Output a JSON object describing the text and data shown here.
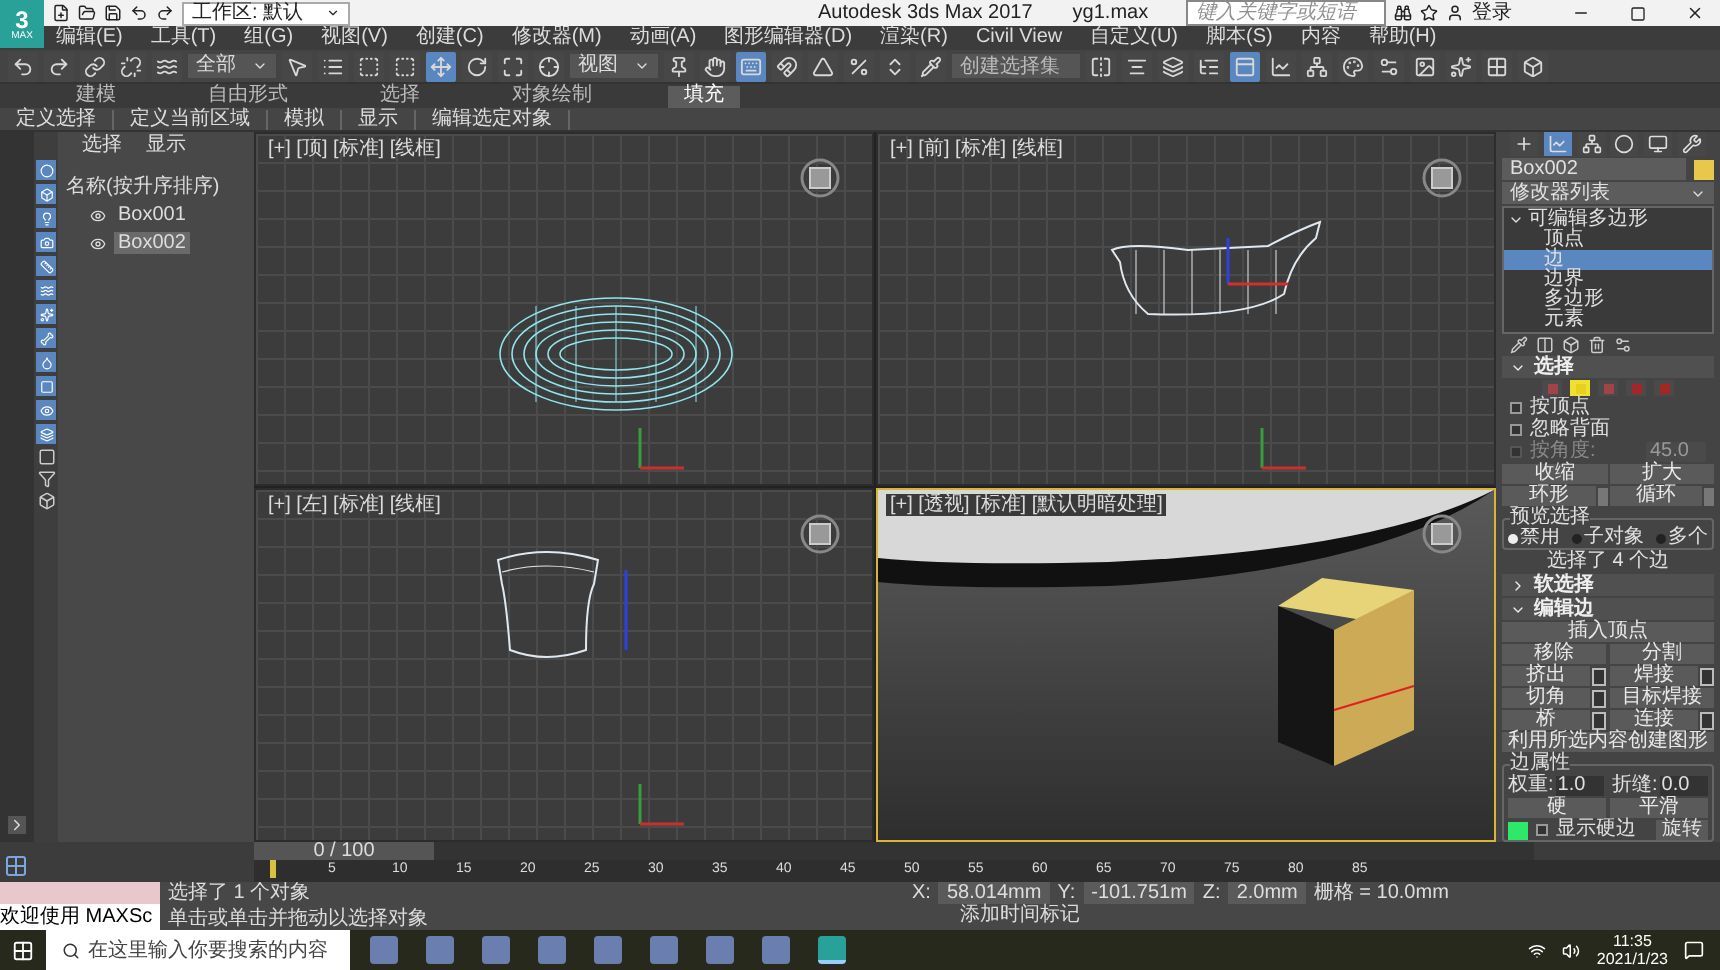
{
  "window": {
    "logo": "3",
    "logo_caption": "MAX",
    "workspace": "工作区: 默认",
    "app_title": "Autodesk 3ds Max 2017",
    "file_name": "yg1.max",
    "search": {
      "placeholder": "键入关键字或短语"
    },
    "sign_in": "登录"
  },
  "menu": [
    "编辑(E)",
    "工具(T)",
    "组(G)",
    "视图(V)",
    "创建(C)",
    "修改器(M)",
    "动画(A)",
    "图形编辑器(D)",
    "渲染(R)",
    "Civil View",
    "自定义(U)",
    "脚本(S)",
    "内容",
    "帮助(H)"
  ],
  "toolbar": [
    {
      "kind": "tool",
      "selected": false
    },
    {
      "kind": "tool",
      "selected": false
    },
    {
      "kind": "tool",
      "selected": false
    },
    {
      "kind": "tool",
      "selected": false
    },
    {
      "kind": "tool",
      "selected": false
    },
    {
      "kind": "dropdown",
      "value": "全部"
    },
    {
      "kind": "tool",
      "selected": false
    },
    {
      "kind": "tool",
      "selected": false
    },
    {
      "kind": "tool",
      "selected": false
    },
    {
      "kind": "tool",
      "selected": false
    },
    {
      "kind": "tool",
      "selected": true
    },
    {
      "kind": "tool",
      "selected": false
    },
    {
      "kind": "tool",
      "selected": false
    },
    {
      "kind": "tool",
      "selected": false
    },
    {
      "kind": "dropdown",
      "value": "视图"
    },
    {
      "kind": "tool",
      "selected": false
    },
    {
      "kind": "tool",
      "selected": false
    },
    {
      "kind": "tool",
      "selected": true
    },
    {
      "kind": "tool",
      "selected": false
    },
    {
      "kind": "tool",
      "selected": false
    },
    {
      "kind": "tool",
      "selected": false
    },
    {
      "kind": "tool",
      "selected": false
    },
    {
      "kind": "tool",
      "selected": false
    },
    {
      "kind": "field",
      "placeholder": "创建选择集"
    },
    {
      "kind": "tool",
      "selected": false
    },
    {
      "kind": "tool",
      "selected": false
    },
    {
      "kind": "tool",
      "selected": false
    },
    {
      "kind": "tool",
      "selected": false
    },
    {
      "kind": "tool",
      "selected": true
    },
    {
      "kind": "tool",
      "selected": false
    },
    {
      "kind": "tool",
      "selected": false
    },
    {
      "kind": "tool",
      "selected": false
    },
    {
      "kind": "tool",
      "selected": false
    },
    {
      "kind": "tool",
      "selected": false
    },
    {
      "kind": "tool",
      "selected": false
    },
    {
      "kind": "tool",
      "selected": false
    },
    {
      "kind": "tool",
      "selected": false
    }
  ],
  "ribbon": {
    "tabs": [
      {
        "label": "建模",
        "selected": false
      },
      {
        "label": "自由形式",
        "selected": false
      },
      {
        "label": "选择",
        "selected": false
      },
      {
        "label": "对象绘制",
        "selected": false
      },
      {
        "label": "填充",
        "selected": true
      }
    ],
    "panels": [
      "定义选择",
      "定义当前区域",
      "模拟",
      "显示",
      "编辑选定对象"
    ]
  },
  "scene_explorer": {
    "tabs": [
      "选择",
      "显示"
    ],
    "column": "名称(按升序排序)",
    "items": [
      {
        "name": "Box001",
        "selected": false
      },
      {
        "name": "Box002",
        "selected": true
      }
    ]
  },
  "viewports": [
    {
      "kind": "top",
      "label": "[+] [顶] [标准] [线框]",
      "active": false
    },
    {
      "kind": "front",
      "label": "[+] [前] [标准] [线框]",
      "active": false
    },
    {
      "kind": "left",
      "label": "[+] [左] [标准] [线框]",
      "active": false
    },
    {
      "kind": "perspective",
      "label": "[+] [透视] [标准] [默认明暗处理]",
      "active": true
    }
  ],
  "command_panel": {
    "tabs": [
      {
        "selected": false
      },
      {
        "selected": true
      },
      {
        "selected": false
      },
      {
        "selected": false
      },
      {
        "selected": false
      },
      {
        "selected": false
      }
    ],
    "object": {
      "name": "Box002",
      "color": "#e8c84a"
    },
    "modifier_list": "修改器列表",
    "stack": [
      {
        "label": "可编辑多边形",
        "expanded": true,
        "selected": false,
        "children": [
          {
            "label": "顶点",
            "selected": false
          },
          {
            "label": "边",
            "selected": true
          },
          {
            "label": "边界",
            "selected": false
          },
          {
            "label": "多边形",
            "selected": false
          },
          {
            "label": "元素",
            "selected": false
          }
        ]
      }
    ],
    "selection": {
      "title": "选择",
      "expanded": true,
      "levels": [
        {
          "selected": false
        },
        {
          "selected": true
        },
        {
          "selected": false
        },
        {
          "selected": false
        },
        {
          "selected": false
        }
      ],
      "options": [
        {
          "label": "按顶点",
          "checked": false,
          "disabled": false
        },
        {
          "label": "忽略背面",
          "checked": false,
          "disabled": false
        },
        {
          "label": "按角度:",
          "checked": false,
          "disabled": true,
          "value": "45.0"
        }
      ],
      "buttons": [
        {
          "label": "收缩",
          "spinner": false
        },
        {
          "label": "扩大",
          "spinner": false
        },
        {
          "label": "环形",
          "spinner": true
        },
        {
          "label": "循环",
          "spinner": true
        }
      ],
      "preview": {
        "title": "预览选择",
        "options": [
          {
            "label": "禁用",
            "selected": true
          },
          {
            "label": "子对象",
            "selected": false
          },
          {
            "label": "多个",
            "selected": false
          }
        ]
      },
      "summary": "选择了 4 个边"
    },
    "soft_selection": {
      "title": "软选择",
      "expanded": false
    },
    "edit_edges": {
      "title": "编辑边",
      "expanded": true,
      "rows": [
        [
          {
            "label": "插入顶点",
            "settings": false
          }
        ],
        [
          {
            "label": "移除",
            "settings": false
          },
          {
            "label": "分割",
            "settings": false
          }
        ],
        [
          {
            "label": "挤出",
            "settings": true
          },
          {
            "label": "焊接",
            "settings": true
          }
        ],
        [
          {
            "label": "切角",
            "settings": true
          },
          {
            "label": "目标焊接",
            "settings": false
          }
        ],
        [
          {
            "label": "桥",
            "settings": true
          },
          {
            "label": "连接",
            "settings": true
          }
        ],
        [
          {
            "label": "利用所选内容创建图形",
            "settings": false
          }
        ]
      ],
      "edge_properties": {
        "title": "边属性",
        "fields": [
          {
            "label": "权重:",
            "value": "1.0"
          },
          {
            "label": "折缝:",
            "value": "0.0"
          }
        ],
        "buttons": [
          "硬",
          "平滑"
        ],
        "color": "#2ee86a",
        "show_hard_edges": {
          "label": "显示硬边",
          "checked": false
        }
      },
      "last_button": "旋转"
    }
  },
  "timeline": {
    "position": "0 / 100",
    "level": 0,
    "frame_labels": [
      "5",
      "10",
      "15",
      "20",
      "25",
      "30",
      "35",
      "40",
      "45",
      "50",
      "55",
      "60",
      "65",
      "70",
      "75",
      "80",
      "85"
    ]
  },
  "status": {
    "script_listener": "欢迎使用 MAXSc",
    "selection": "选择了 1 个对象",
    "prompt": "单击或单击并拖动以选择对象",
    "coords": [
      {
        "axis": "X:",
        "value": "58.014mm"
      },
      {
        "axis": "Y:",
        "value": "-101.751m"
      },
      {
        "axis": "Z:",
        "value": "2.0mm"
      }
    ],
    "grid": "栅格 = 10.0mm",
    "add_time_tag": "添加时间标记"
  },
  "taskbar": {
    "search": {
      "placeholder": "在这里输入你要搜索的内容"
    },
    "apps": [
      {
        "selected": false
      },
      {
        "selected": false
      },
      {
        "selected": false
      },
      {
        "selected": false
      },
      {
        "selected": false
      },
      {
        "selected": false
      },
      {
        "selected": false
      },
      {
        "selected": false
      },
      {
        "selected": true
      }
    ],
    "time": "11:35",
    "date": "2021/1/23"
  }
}
